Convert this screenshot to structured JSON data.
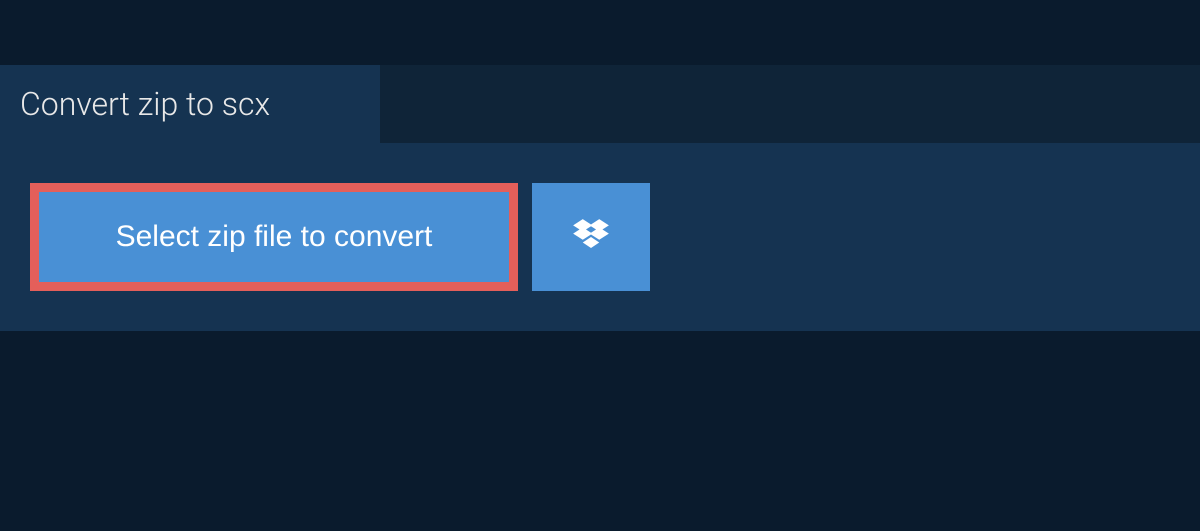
{
  "tab": {
    "title": "Convert zip to scx"
  },
  "actions": {
    "select_file_label": "Select zip file to convert"
  },
  "colors": {
    "bg_dark": "#0a1b2d",
    "bg_panel": "#153351",
    "bg_body": "#0f2438",
    "accent_blue": "#4990d5",
    "accent_red_border": "#e45f5a"
  }
}
